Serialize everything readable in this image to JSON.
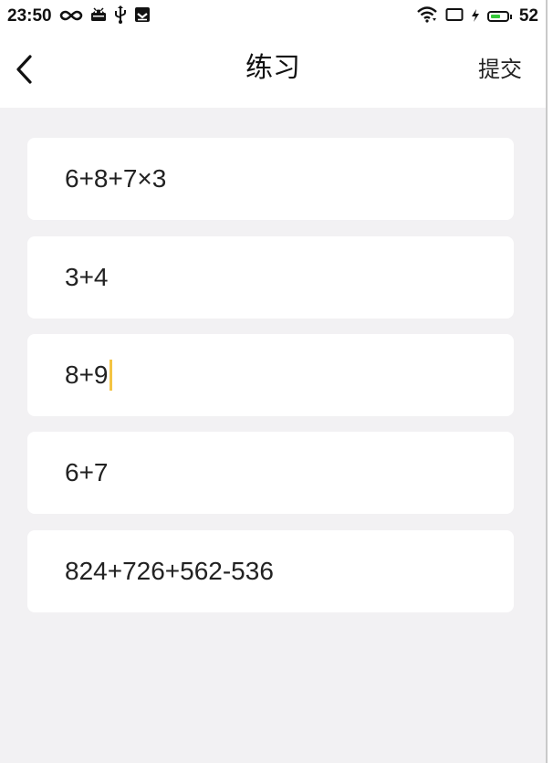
{
  "status_bar": {
    "time": "23:50",
    "battery_percent": "52",
    "battery_level": 0.52,
    "battery_color": "#36c93a",
    "left_icons": [
      "infinity-icon",
      "android-icon",
      "usb-icon",
      "download-box-icon"
    ],
    "right_icons": [
      "wifi-icon",
      "screen-icon",
      "charging-bolt-icon",
      "battery-icon"
    ]
  },
  "header": {
    "back_icon": "chevron-left-icon",
    "title": "练习",
    "submit_label": "提交"
  },
  "questions": [
    {
      "expression": "6+8+7×3"
    },
    {
      "expression": "3+4"
    },
    {
      "expression": "8+9",
      "focused": true
    },
    {
      "expression": "6+7"
    },
    {
      "expression": "824+726+562-536"
    }
  ],
  "colors": {
    "background": "#f2f1f3",
    "card": "#ffffff",
    "caret": "#f4c443"
  }
}
